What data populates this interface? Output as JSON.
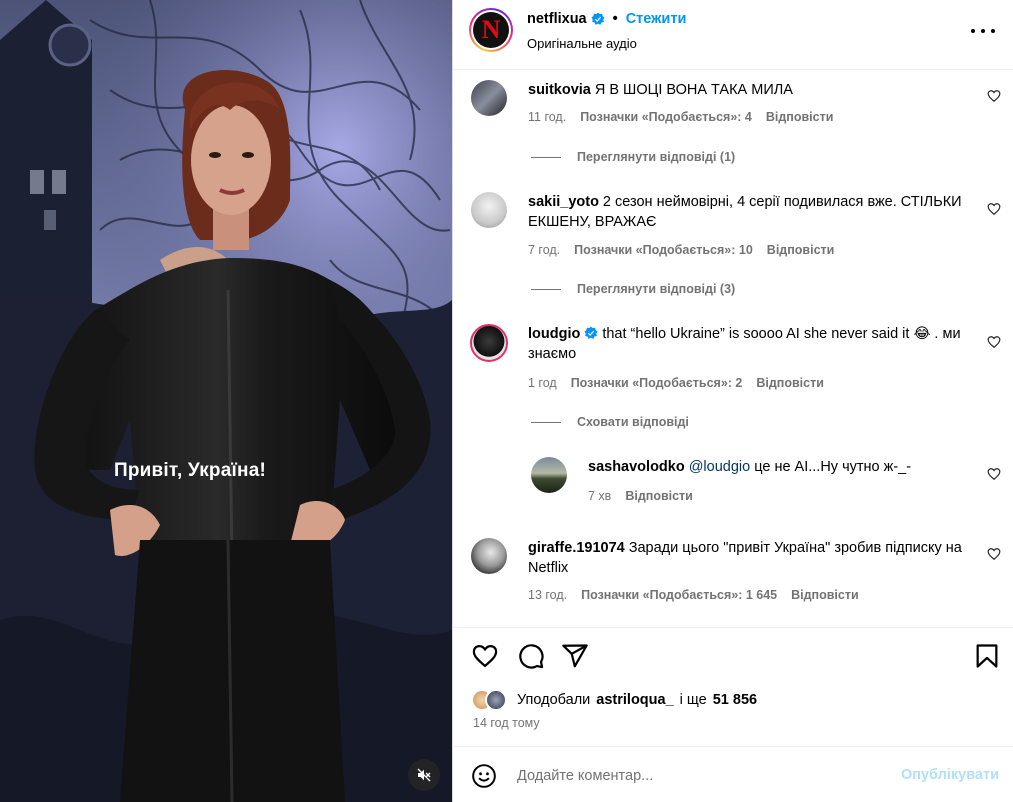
{
  "video": {
    "caption": "Привіт, Україна!",
    "mute_icon": "speaker-muted-icon"
  },
  "header": {
    "username": "netflixua",
    "logo_letter": "N",
    "separator": "•",
    "follow_label": "Стежити",
    "audio_label": "Оригінальне аудіо",
    "more_icon": "more-options-icon"
  },
  "comments": [
    {
      "username": "suitkovia",
      "text": "Я В ШОЦІ ВОНА ТАКА МИЛА",
      "time": "11 год.",
      "likes": "Позначки «Подобається»: 4",
      "reply": "Відповісти",
      "replies_toggle": "Переглянути відповіді (1)"
    },
    {
      "username": "sakii_yoto",
      "text": "2 сезон неймовірні, 4 серії подивилася вже. СТІЛЬКИ ЕКШЕНУ, ВРАЖАЄ",
      "time": "7 год.",
      "likes": "Позначки «Подобається»: 10",
      "reply": "Відповісти",
      "replies_toggle": "Переглянути відповіді (3)"
    },
    {
      "username": "loudgio",
      "text": "that “hello Ukraine” is soooo AI she never said it 😂 . ми знаємо",
      "time": "1 год",
      "likes": "Позначки «Подобається»: 2",
      "reply": "Відповісти",
      "replies_toggle": "Сховати відповіді",
      "reply_item": {
        "username": "sashavolodko",
        "mention": "@loudgio",
        "text": "це не AI...Ну чутно ж-_-",
        "time": "7 хв",
        "reply": "Відповісти"
      }
    },
    {
      "username": "giraffe.191074",
      "text": "Заради цього \"привіт Україна\" зробив підписку на Netflix",
      "time": "13 год.",
      "likes": "Позначки «Подобається»: 1 645",
      "reply": "Відповісти"
    }
  ],
  "actions": {
    "like_icon": "heart-icon",
    "comment_icon": "comment-bubble-icon",
    "share_icon": "share-paper-plane-icon",
    "save_icon": "bookmark-icon"
  },
  "likes": {
    "prefix": "Уподобали",
    "user": "astriloqua_",
    "conj": "і ще",
    "count": "51 856"
  },
  "time_ago": "14 год тому",
  "comment_box": {
    "placeholder": "Додайте коментар...",
    "publish_label": "Опублікувати",
    "emoji_icon": "smiley-icon"
  },
  "colors": {
    "link_blue": "#0095f6",
    "publish_disabled": "#b2dffc",
    "muted_text": "#737373",
    "netflix_red": "#e50914"
  }
}
